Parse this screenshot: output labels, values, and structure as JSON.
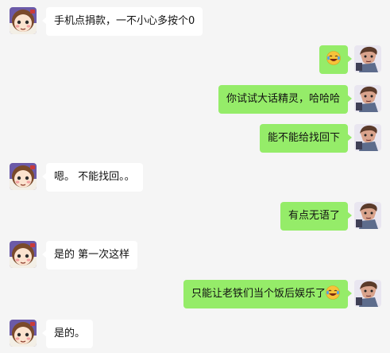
{
  "messages": [
    {
      "side": "in",
      "text": "手机点捐款，一不小心多按个0"
    },
    {
      "side": "out",
      "text": "",
      "emoji": "laugh-cry-emoji"
    },
    {
      "side": "out",
      "text": "你试试大话精灵，哈哈哈"
    },
    {
      "side": "out",
      "text": "能不能给找回下"
    },
    {
      "side": "in",
      "text": "嗯。 不能找回。。"
    },
    {
      "side": "out",
      "text": "有点无语了"
    },
    {
      "side": "in",
      "text": "是的 第一次这样"
    },
    {
      "side": "out",
      "text": "只能让老铁们当个饭后娱乐了",
      "emoji": "laugh-cry-emoji"
    },
    {
      "side": "in",
      "text": "是的。"
    }
  ],
  "colors": {
    "background": "#f5f5f5",
    "incoming_bubble": "#ffffff",
    "outgoing_bubble": "#95ec69"
  }
}
